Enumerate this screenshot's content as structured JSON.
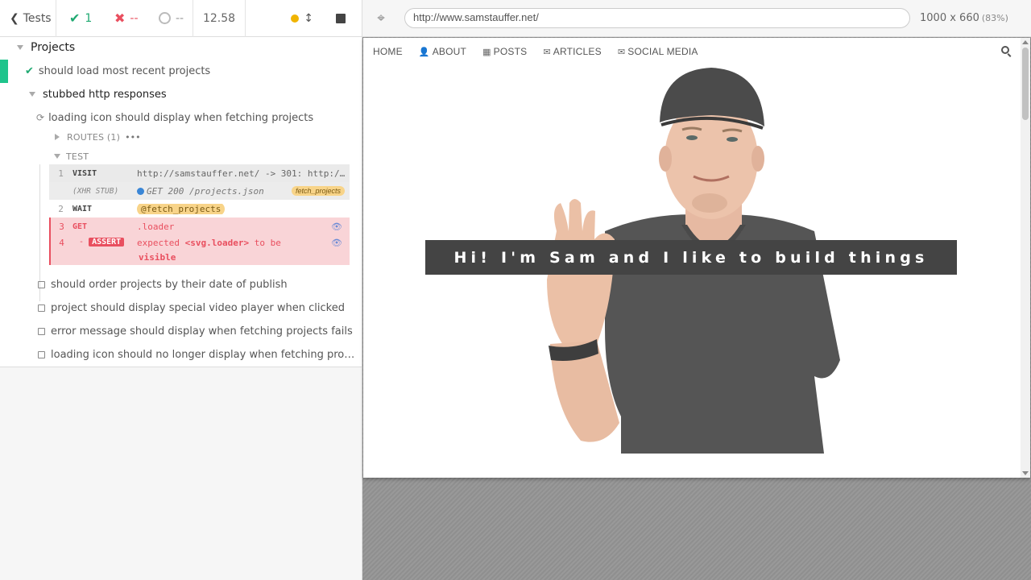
{
  "stats": {
    "tests_label": "Tests",
    "passed": "1",
    "failed": "--",
    "pending": "--",
    "duration": "12.58"
  },
  "runnables": {
    "suite": "Projects",
    "test_pass": "should load most recent projects",
    "nested_suite": "stubbed http responses",
    "running_test": "loading icon should display when fetching projects",
    "routes_label": "ROUTES (1)",
    "routes_more": "•••",
    "test_label": "TEST",
    "commands": [
      {
        "num": "1",
        "name": "VISIT",
        "message": "http://samstauffer.net/ -> 301: http:/…"
      },
      {
        "num": "",
        "name": "(XHR STUB)",
        "message": "GET 200 /projects.json",
        "alias": "fetch_projects"
      },
      {
        "num": "2",
        "name": "WAIT",
        "message": "@fetch_projects"
      },
      {
        "num": "3",
        "name": "GET",
        "message": ".loader"
      },
      {
        "num": "4",
        "name": "ASSERT",
        "dash": "-",
        "message_pre": "expected ",
        "message_sel": "<svg.loader>",
        "message_post": " to be",
        "message_bold": "visible"
      }
    ],
    "pending_tests": [
      "should order projects by their date of publish",
      "project should display special video player when clicked",
      "error message should display when fetching projects fails",
      "loading icon should no longer display when fetching pro…"
    ]
  },
  "aut": {
    "url": "http://www.samstauffer.net/",
    "viewport": "1000 x 660",
    "scale": "(83%)",
    "nav": {
      "home": "HOME",
      "about": "ABOUT",
      "posts": "POSTS",
      "articles": "ARTICLES",
      "social": "SOCIAL MEDIA"
    },
    "hero_text": "Hi! I'm Sam and I like to build things"
  },
  "colors": {
    "pass": "#1fa971",
    "fail": "#e94f5f",
    "pending_yellow": "#f0b400",
    "banner_bg": "#444444"
  }
}
